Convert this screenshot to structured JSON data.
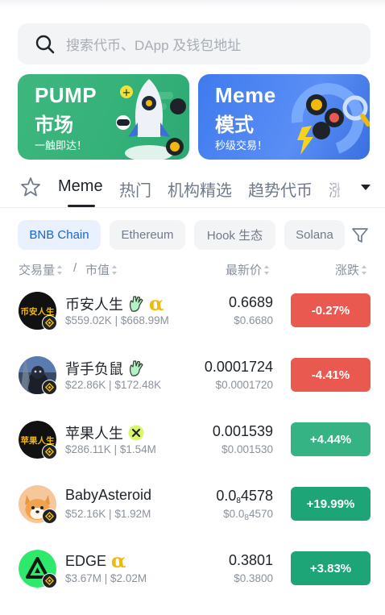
{
  "search": {
    "placeholder": "搜索代币、DApp 及钱包地址"
  },
  "banners": [
    {
      "title1": "PUMP",
      "title2": "市场",
      "subtitle": "一触即达！"
    },
    {
      "title1": "Meme",
      "title2": "模式",
      "subtitle": "秒级交易！"
    }
  ],
  "tabs": [
    "Meme",
    "热门",
    "机构精选",
    "趋势代币",
    "涨"
  ],
  "chains": [
    "BNB Chain",
    "Ethereum",
    "Hook 生态",
    "Solana"
  ],
  "columns": {
    "volume": "交易量",
    "sep": "/",
    "mcap": "市值",
    "price": "最新价",
    "change": "涨跌"
  },
  "tokens": [
    {
      "name": "币安人生",
      "avatar_text": "币安人生",
      "volume": "$559.02K",
      "mcap": "$668.99M",
      "price": "0.6689",
      "price_usd": "$0.6680",
      "change": "-0.27%",
      "icons": [
        "hand-icon",
        "alpha-icon"
      ]
    },
    {
      "name": "背手负鼠",
      "volume": "$22.86K",
      "mcap": "$172.48K",
      "price": "0.0001724",
      "price_usd": "$0.0001720",
      "change": "-4.41%",
      "icons": [
        "hand-icon"
      ]
    },
    {
      "name": "苹果人生",
      "avatar_text": "苹果人生",
      "volume": "$286.11K",
      "mcap": "$1.54M",
      "price": "0.001539",
      "price_usd": "$0.001530",
      "change": "+4.44%",
      "icons": [
        "x-badge-icon"
      ]
    },
    {
      "name": "BabyAsteroid",
      "volume": "$52.16K",
      "mcap": "$1.92M",
      "price_pre": "0.0",
      "price_zeros": "8",
      "price_post": "4578",
      "price_usd_pre": "$0.0",
      "price_usd_zeros": "8",
      "price_usd_post": "4570",
      "change": "+19.99%",
      "icons": []
    },
    {
      "name": "EDGE",
      "volume": "$3.67M",
      "mcap": "$2.02M",
      "price": "0.3801",
      "price_usd": "$0.3800",
      "change": "+3.83%",
      "icons": [
        "alpha-icon"
      ]
    }
  ],
  "alpha_symbol": "α",
  "colors": {
    "down": "#e9594f",
    "up_light": "#36b384",
    "up": "#1da578",
    "accent": "#1a63d6",
    "gold": "#f0b90b"
  }
}
